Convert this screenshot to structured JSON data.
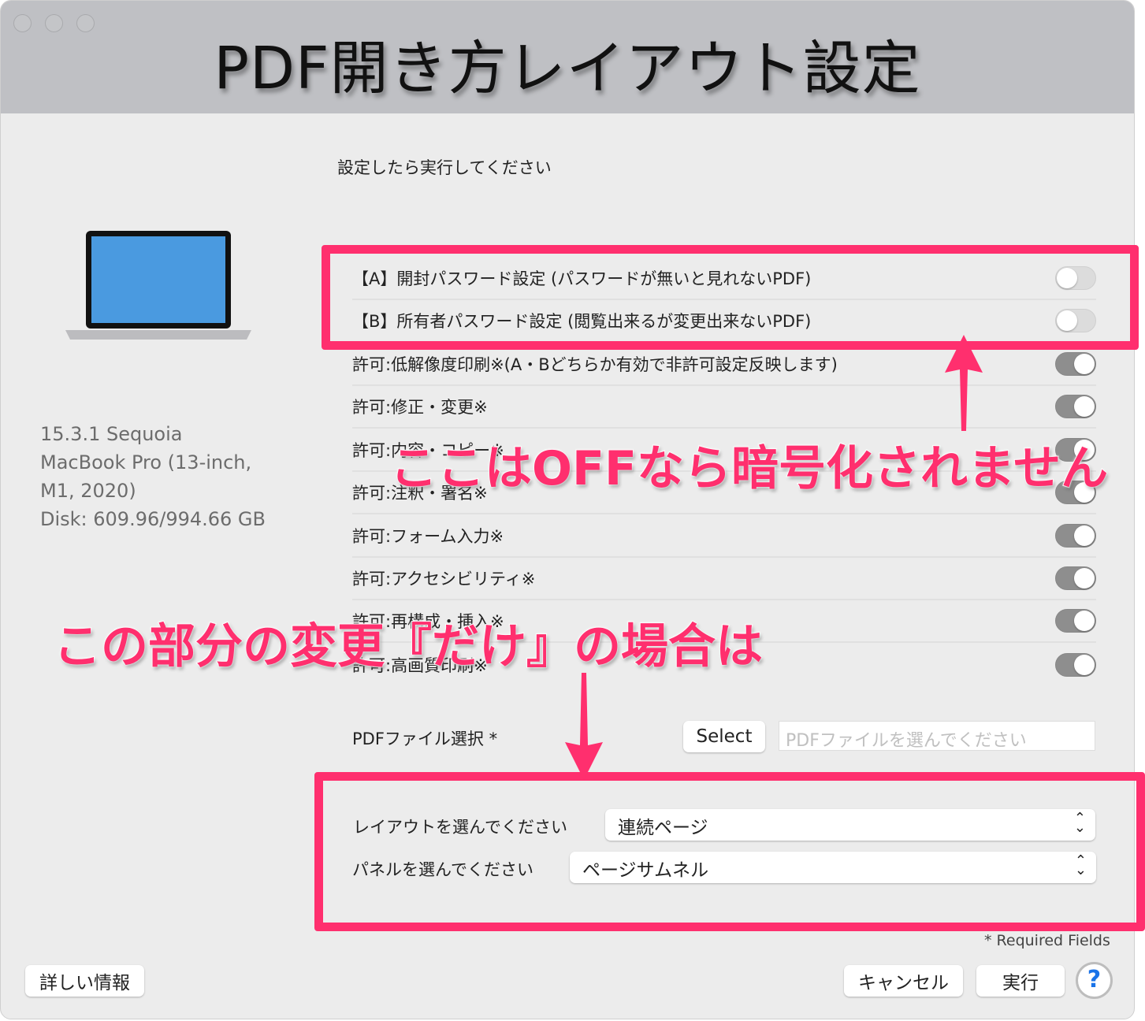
{
  "window": {
    "title": "PDF開き方レイアウト設定"
  },
  "instruction": "設定したら実行してください",
  "device_info": [
    "15.3.1 Sequoia",
    "MacBook Pro (13-inch,",
    "M1, 2020)",
    "Disk: 609.96/994.66 GB"
  ],
  "toggles": [
    {
      "label": "【A】開封パスワード設定 (パスワードが無いと見れないPDF)",
      "on": false
    },
    {
      "label": "【B】所有者パスワード設定 (閲覧出来るが変更出来ないPDF)",
      "on": false
    },
    {
      "label": "許可:低解像度印刷※(A・Bどちらか有効で非許可設定反映します)",
      "on": true
    },
    {
      "label": "許可:修正・変更※",
      "on": true
    },
    {
      "label": "許可:内容・コピー※",
      "on": true
    },
    {
      "label": "許可:注釈・署名※",
      "on": true
    },
    {
      "label": "許可:フォーム入力※",
      "on": true
    },
    {
      "label": "許可:アクセシビリティ※",
      "on": true
    },
    {
      "label": "許可:再構成・挿入※",
      "on": true
    },
    {
      "label": "許可:高画質印刷※",
      "on": true
    }
  ],
  "file": {
    "label": "PDFファイル選択 *",
    "select_button": "Select",
    "placeholder": "PDFファイルを選んでください"
  },
  "layout": {
    "label": "レイアウトを選んでください",
    "value": "連続ページ"
  },
  "panel": {
    "label": "パネルを選んでください",
    "value": "ページサムネル"
  },
  "required_note": "* Required Fields",
  "buttons": {
    "details": "詳しい情報",
    "cancel": "キャンセル",
    "run": "実行",
    "help": "?"
  },
  "annotations": {
    "top": "ここはOFFなら暗号化されません",
    "middle": "この部分の変更『だけ』の場合は"
  },
  "colors": {
    "annotation": "#ff2f6e"
  }
}
